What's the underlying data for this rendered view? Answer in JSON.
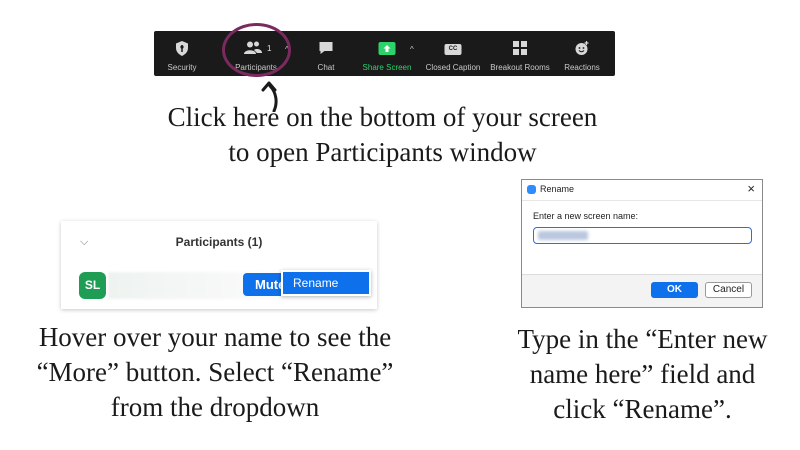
{
  "toolbar": {
    "items": [
      {
        "label": "Security",
        "icon": "shield-icon"
      },
      {
        "label": "Participants",
        "icon": "participants-icon",
        "count": "1"
      },
      {
        "label": "Chat",
        "icon": "chat-icon"
      },
      {
        "label": "Share Screen",
        "icon": "share-screen-icon"
      },
      {
        "label": "Closed Caption",
        "icon": "closed-caption-icon",
        "icon_text": "CC"
      },
      {
        "label": "Breakout Rooms",
        "icon": "breakout-rooms-icon"
      },
      {
        "label": "Reactions",
        "icon": "reactions-icon"
      }
    ],
    "share_color": "#2dd26b"
  },
  "instructions": {
    "top": [
      "Click here on the bottom of your screen",
      "to open Participants window"
    ],
    "left": [
      "Hover over your name to see the",
      "“More” button. Select “Rename”",
      "from the dropdown"
    ],
    "right": [
      "Type in the “Enter new",
      "name here” field and",
      "click “Rename”."
    ]
  },
  "participants_panel": {
    "title": "Participants (1)",
    "avatar_initials": "SL",
    "mute_label": "Mute",
    "dropdown_item": "Rename"
  },
  "rename_dialog": {
    "title": "Rename",
    "close": "×",
    "prompt": "Enter a new screen name:",
    "ok_label": "OK",
    "cancel_label": "Cancel"
  },
  "colors": {
    "accent_blue": "#0e71eb",
    "highlight_circle": "#7a2a5e",
    "avatar_green": "#1f9d55"
  }
}
